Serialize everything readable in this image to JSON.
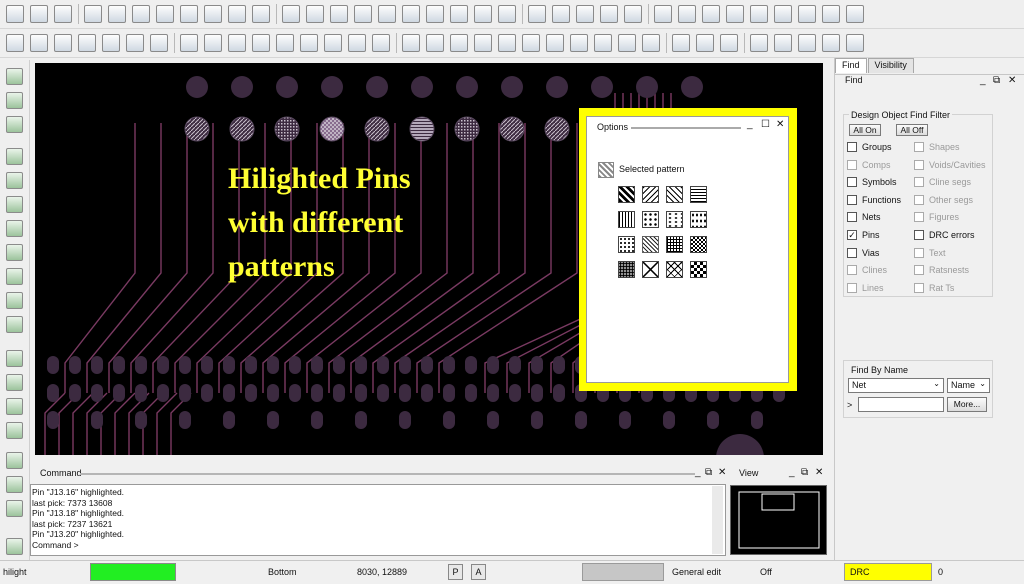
{
  "toolbar": {
    "row1_icons": [
      "new-icon",
      "open-icon",
      "save-icon",
      "move-icon",
      "copy-icon",
      "delete-icon",
      "undo-icon",
      "redo-icon",
      "dropdown-icon",
      "shape-icon",
      "pin-tool-icon",
      "grid-icon",
      "zoom-fit-icon",
      "zoom-in-icon",
      "zoom-out-icon",
      "zoom-world-icon",
      "zoom-window-icon",
      "zoom-previous-icon",
      "refresh-icon",
      "view-3d-icon",
      "flip-icon",
      "grid-toggle-icon",
      "layers-icon",
      "color-icon",
      "dehilight-icon",
      "stats-icon",
      "info-icon",
      "property-icon",
      "measure-icon",
      "brush-icon",
      "sun-icon",
      "sparkle-icon",
      "bars-icon",
      "hourglass-icon",
      "hilight-icon"
    ],
    "row2_icons": [
      "place-icon",
      "layer-icon",
      "group-icon",
      "via-icon",
      "symbol-icon",
      "shape-add-icon",
      "cline-icon",
      "rect-icon",
      "circle-icon",
      "select-icon",
      "move-point-icon",
      "arc-icon",
      "poly-icon",
      "void-icon",
      "board-icon",
      "dimension-icon",
      "measure-h-icon",
      "measure-v-icon",
      "cell-icon",
      "library-icon",
      "text-icon",
      "camera-icon",
      "barcode-icon",
      "logo-icon",
      "trace-icon",
      "drill-icon",
      "grid-dots-icon",
      "analysis-icon",
      "route-icon",
      "net-icon",
      "cut-icon",
      "check-icon",
      "swap-icon",
      "window-icon",
      "export-icon"
    ]
  },
  "canvas": {
    "headline": [
      "Hilighted Pins",
      "with different",
      "patterns"
    ],
    "colors": {
      "background": "#000000",
      "trace": "#7a3a62",
      "pad": "#3c2a40",
      "headline": "#ffff33"
    }
  },
  "options_panel": {
    "title": "Options",
    "selected_pattern_label": "Selected pattern",
    "patterns": [
      "p1",
      "p2",
      "p3",
      "p4",
      "p5",
      "p6",
      "p7",
      "p8",
      "p9",
      "p10",
      "p11",
      "p12",
      "p13",
      "p14",
      "p15",
      "p16"
    ],
    "frame_color": "#ffff00"
  },
  "right_panel": {
    "tabs": [
      {
        "label": "Find",
        "active": true
      },
      {
        "label": "Visibility",
        "active": false
      }
    ],
    "section_title": "Find",
    "filter_title": "Design Object Find Filter",
    "all_on": "All On",
    "all_off": "All Off",
    "left_items": [
      {
        "label": "Groups",
        "checked": false,
        "enabled": true
      },
      {
        "label": "Comps",
        "checked": false,
        "enabled": false
      },
      {
        "label": "Symbols",
        "checked": false,
        "enabled": true
      },
      {
        "label": "Functions",
        "checked": false,
        "enabled": true
      },
      {
        "label": "Nets",
        "checked": false,
        "enabled": true
      },
      {
        "label": "Pins",
        "checked": true,
        "enabled": true
      },
      {
        "label": "Vias",
        "checked": false,
        "enabled": true
      },
      {
        "label": "Clines",
        "checked": false,
        "enabled": false
      },
      {
        "label": "Lines",
        "checked": false,
        "enabled": false
      }
    ],
    "right_items": [
      {
        "label": "Shapes",
        "checked": false,
        "enabled": false
      },
      {
        "label": "Voids/Cavities",
        "checked": false,
        "enabled": false
      },
      {
        "label": "Cline segs",
        "checked": false,
        "enabled": false
      },
      {
        "label": "Other segs",
        "checked": false,
        "enabled": false
      },
      {
        "label": "Figures",
        "checked": false,
        "enabled": false
      },
      {
        "label": "DRC errors",
        "checked": false,
        "enabled": true
      },
      {
        "label": "Text",
        "checked": false,
        "enabled": false
      },
      {
        "label": "Ratsnests",
        "checked": false,
        "enabled": false
      },
      {
        "label": "Rat Ts",
        "checked": false,
        "enabled": false
      }
    ],
    "find_by_name": {
      "title": "Find By Name",
      "type_value": "Net",
      "mode_value": "Name",
      "prompt": ">",
      "input_value": "",
      "more_button": "More..."
    }
  },
  "command": {
    "title": "Command",
    "lines": [
      "Pin \"J13.16\" highlighted.",
      "last pick:  7373 13608",
      "Pin \"J13.18\" highlighted.",
      "last pick:  7237 13621",
      "Pin \"J13.20\" highlighted.",
      "Command >"
    ]
  },
  "view": {
    "title": "View"
  },
  "statusbar": {
    "command_name": "hilight",
    "layer": "Bottom",
    "coordinates": "8030, 12889",
    "p_button": "P",
    "a_button": "A",
    "mode": "General edit",
    "state": "Off",
    "drc_label": "DRC",
    "drc_count": "0",
    "colors": {
      "idle": "#22ee22",
      "drc": "#ffff00"
    }
  }
}
